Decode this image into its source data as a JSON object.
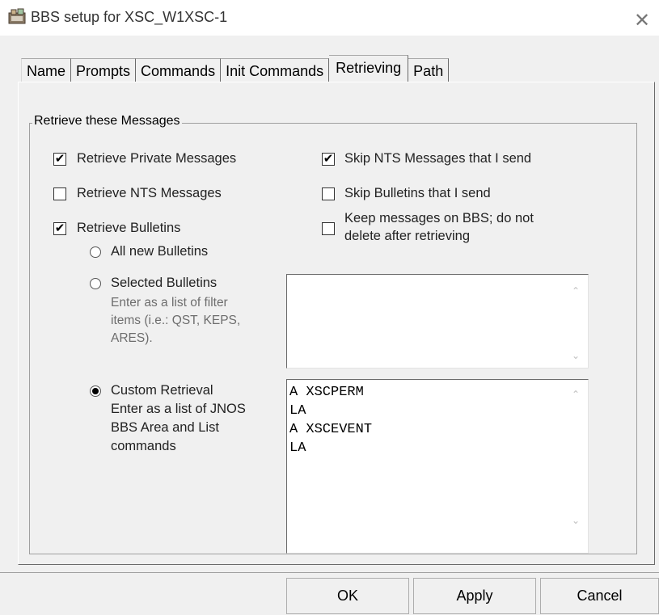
{
  "window": {
    "title": "BBS setup for XSC_W1XSC-1",
    "icon": "bbs-app-icon",
    "close_glyph": "✕"
  },
  "tabs": [
    {
      "label": "Name",
      "active": false
    },
    {
      "label": "Prompts",
      "active": false
    },
    {
      "label": "Commands",
      "active": false
    },
    {
      "label": "Init Commands",
      "active": false
    },
    {
      "label": "Retrieving",
      "active": true
    },
    {
      "label": "Path",
      "active": false
    }
  ],
  "group": {
    "title": "Retrieve these Messages"
  },
  "options": {
    "retrieve_private": {
      "label": "Retrieve Private Messages",
      "checked": true
    },
    "retrieve_nts": {
      "label": "Retrieve NTS Messages",
      "checked": false
    },
    "retrieve_bulletins": {
      "label": "Retrieve Bulletins",
      "checked": true
    },
    "skip_nts_sent": {
      "label": "Skip NTS Messages that I send",
      "checked": true
    },
    "skip_bulletins_sent": {
      "label": "Skip Bulletins that I send",
      "checked": false
    },
    "keep_on_bbs": {
      "label_line1": "Keep messages on BBS; do not",
      "label_line2": "delete after retrieving",
      "checked": false
    }
  },
  "bulletin_modes": {
    "all_new": {
      "label": "All new Bulletins",
      "selected": false
    },
    "selected": {
      "label": "Selected Bulletins",
      "hint_line1": "Enter as a list of filter",
      "hint_line2": "items (i.e.: QST, KEPS,",
      "hint_line3": "ARES).",
      "selected": false
    },
    "custom": {
      "label": "Custom Retrieval",
      "hint_line1": "Enter as a list of JNOS",
      "hint_line2": "BBS Area and List",
      "hint_line3": "commands",
      "selected": true
    }
  },
  "selected_bulletins_text": "",
  "custom_retrieval_lines": [
    "A XSCPERM",
    "LA",
    "A XSCEVENT",
    "LA"
  ],
  "buttons": {
    "ok": "OK",
    "apply": "Apply",
    "cancel": "Cancel"
  },
  "glyphs": {
    "check": "✔",
    "scroll_up": "⌃",
    "scroll_down": "⌄"
  }
}
